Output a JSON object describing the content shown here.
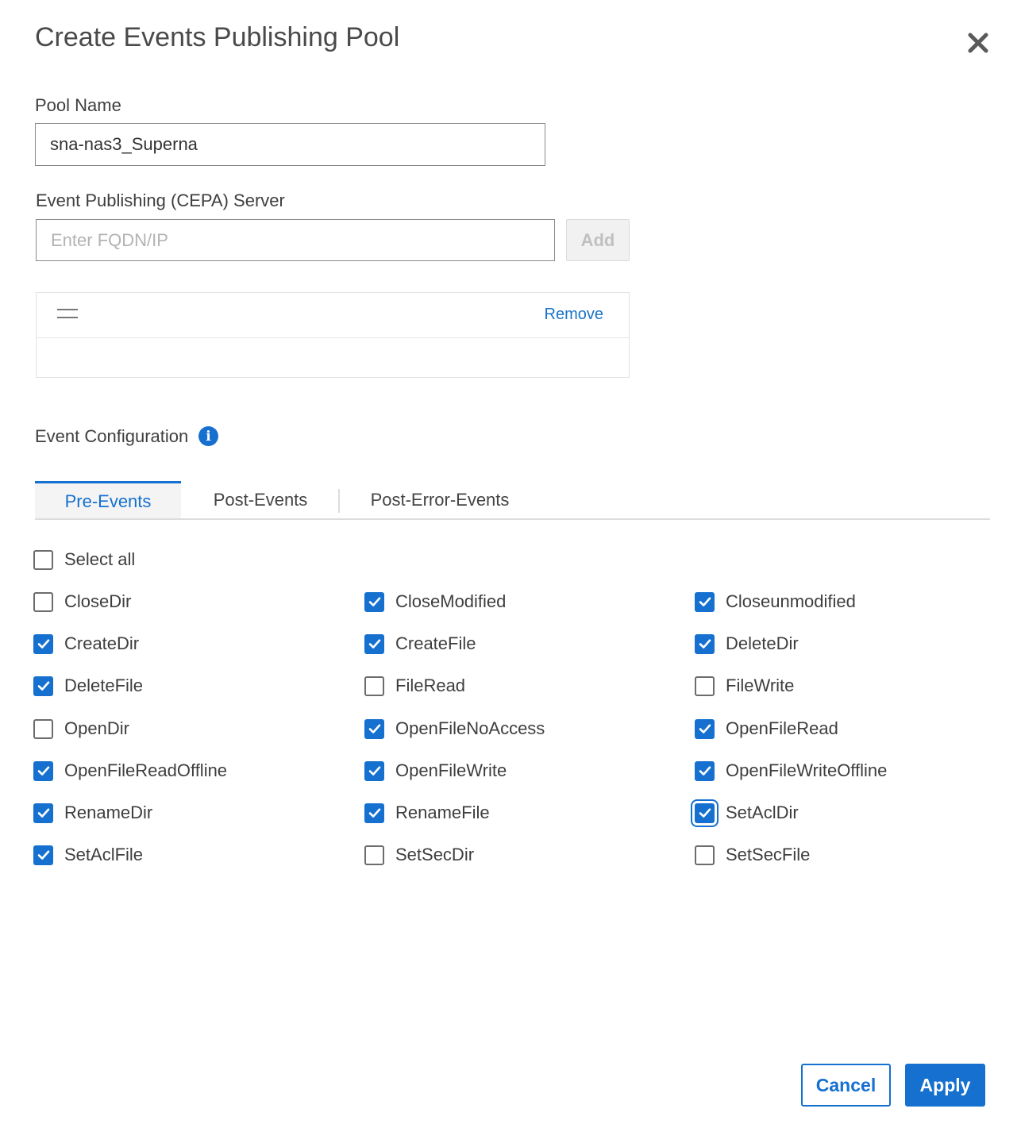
{
  "dialog": {
    "title": "Create Events Publishing Pool",
    "close_icon": "close-icon"
  },
  "pool_name": {
    "label": "Pool Name",
    "value": "sna-nas3_Superna"
  },
  "cepa_server": {
    "label": "Event Publishing (CEPA) Server",
    "placeholder": "Enter FQDN/IP",
    "value": "",
    "add_label": "Add",
    "list": {
      "items": [
        {
          "value": "",
          "remove_label": "Remove"
        }
      ]
    }
  },
  "event_configuration": {
    "label": "Event Configuration",
    "info_icon": "info-icon",
    "tabs": [
      {
        "label": "Pre-Events",
        "active": true
      },
      {
        "label": "Post-Events",
        "active": false
      },
      {
        "label": "Post-Error-Events",
        "active": false
      }
    ],
    "select_all": {
      "label": "Select all",
      "checked": false
    },
    "events": [
      {
        "label": "CloseDir",
        "checked": false
      },
      {
        "label": "CloseModified",
        "checked": true
      },
      {
        "label": "Closeunmodified",
        "checked": true
      },
      {
        "label": "CreateDir",
        "checked": true
      },
      {
        "label": "CreateFile",
        "checked": true
      },
      {
        "label": "DeleteDir",
        "checked": true
      },
      {
        "label": "DeleteFile",
        "checked": true
      },
      {
        "label": "FileRead",
        "checked": false
      },
      {
        "label": "FileWrite",
        "checked": false
      },
      {
        "label": "OpenDir",
        "checked": false
      },
      {
        "label": "OpenFileNoAccess",
        "checked": true
      },
      {
        "label": "OpenFileRead",
        "checked": true
      },
      {
        "label": "OpenFileReadOffline",
        "checked": true
      },
      {
        "label": "OpenFileWrite",
        "checked": true
      },
      {
        "label": "OpenFileWriteOffline",
        "checked": true
      },
      {
        "label": "RenameDir",
        "checked": true
      },
      {
        "label": "RenameFile",
        "checked": true
      },
      {
        "label": "SetAclDir",
        "checked": true,
        "focused": true
      },
      {
        "label": "SetAclFile",
        "checked": true
      },
      {
        "label": "SetSecDir",
        "checked": false
      },
      {
        "label": "SetSecFile",
        "checked": false
      }
    ]
  },
  "footer": {
    "cancel_label": "Cancel",
    "apply_label": "Apply"
  },
  "colors": {
    "accent": "#1570cf",
    "text": "#3e3e3e",
    "border": "#8a8a8a"
  }
}
